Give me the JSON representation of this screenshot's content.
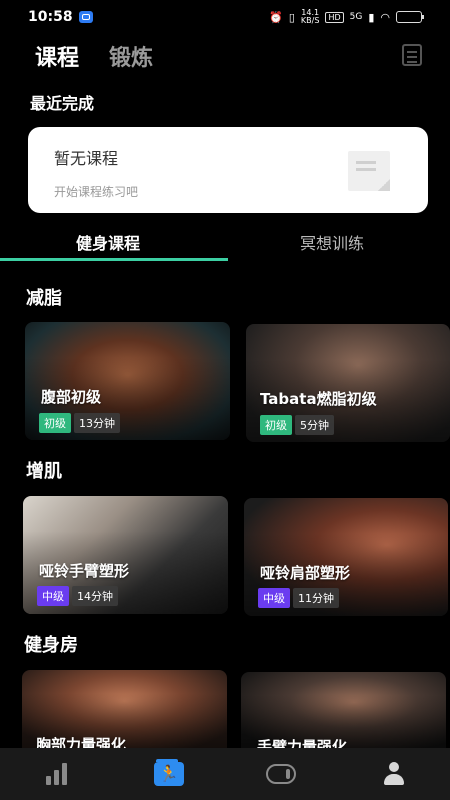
{
  "status_bar": {
    "time": "10:58",
    "network_speed_value": "14.1",
    "network_speed_unit": "KB/S",
    "hd_badge": "HD",
    "signal_label": "5G",
    "battery_level": 0.7
  },
  "header": {
    "tabs": [
      {
        "label": "课程",
        "active": true
      },
      {
        "label": "锻炼",
        "active": false
      }
    ],
    "right_icon": "document-icon"
  },
  "recent": {
    "title": "最近完成",
    "empty_title": "暂无课程",
    "empty_subtitle": "开始课程练习吧"
  },
  "sub_tabs": [
    {
      "label": "健身课程",
      "active": true
    },
    {
      "label": "冥想训练",
      "active": false
    }
  ],
  "categories": [
    {
      "title": "减脂",
      "courses": [
        {
          "name": "腹部初级",
          "level": "初级",
          "duration": "13分钟",
          "level_color": "#2fb87e"
        },
        {
          "name": "Tabata燃脂初级",
          "level": "初级",
          "duration": "5分钟",
          "level_color": "#2fb87e"
        }
      ]
    },
    {
      "title": "增肌",
      "courses": [
        {
          "name": "哑铃手臂塑形",
          "level": "中级",
          "duration": "14分钟",
          "level_color": "#6a3cf0"
        },
        {
          "name": "哑铃肩部塑形",
          "level": "中级",
          "duration": "11分钟",
          "level_color": "#6a3cf0"
        }
      ]
    },
    {
      "title": "健身房",
      "courses": [
        {
          "name": "胸部力量强化"
        },
        {
          "name": "手臂力量强化"
        }
      ]
    }
  ],
  "bottom_nav": [
    {
      "icon": "bar-chart-icon",
      "active": false
    },
    {
      "icon": "running-icon",
      "active": true
    },
    {
      "icon": "pill-toggle-icon",
      "active": false
    },
    {
      "icon": "user-icon",
      "active": false
    }
  ],
  "colors": {
    "accent": "#3ccfa3",
    "beginner_tag": "#2fb87e",
    "intermediate_tag": "#6a3cf0",
    "nav_active": "#2d8cf0"
  }
}
